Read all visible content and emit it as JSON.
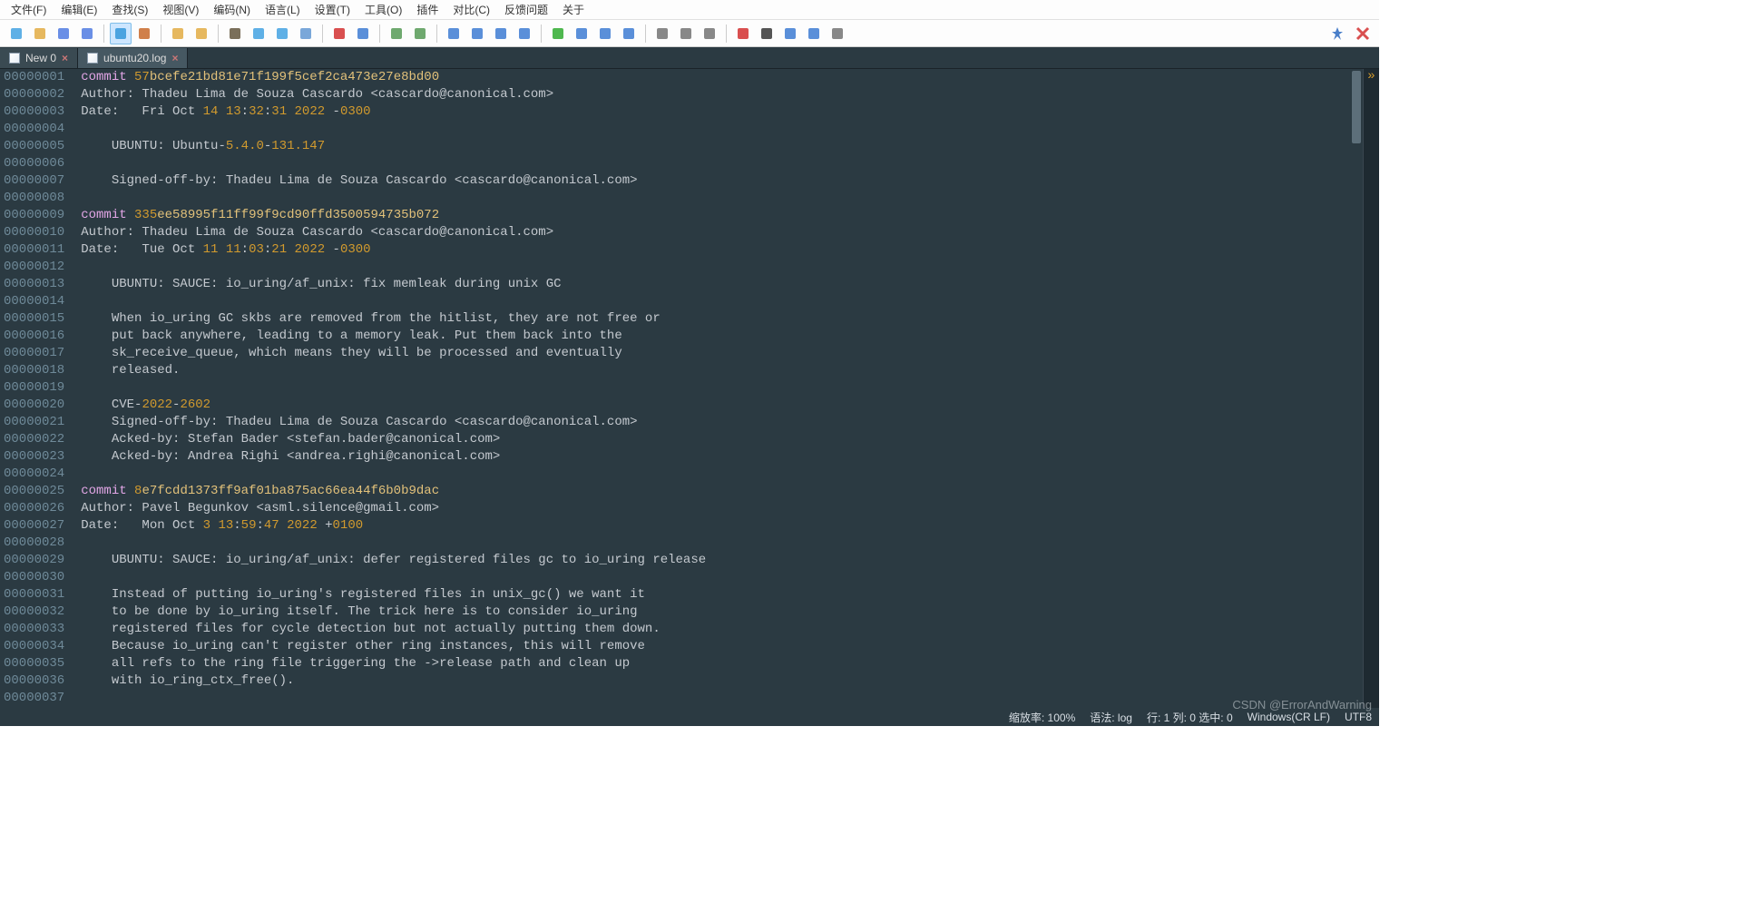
{
  "menu": {
    "items": [
      "文件(F)",
      "编辑(E)",
      "查找(S)",
      "视图(V)",
      "编码(N)",
      "语言(L)",
      "设置(T)",
      "工具(O)",
      "插件",
      "对比(C)",
      "反馈问题",
      "关于"
    ]
  },
  "toolbar": {
    "icons": [
      "new-file-icon",
      "open-folder-icon",
      "save-icon",
      "save-all-icon",
      "sep",
      "clipboard-icon",
      "cut-icon",
      "sep",
      "undo-icon",
      "redo-icon",
      "sep",
      "binoculars-icon",
      "find-replace-icon",
      "doc-search-icon",
      "indent-guide-icon",
      "sep",
      "highlight-red-icon",
      "highlight-blue-icon",
      "sep",
      "zoom-in-icon",
      "zoom-out-icon",
      "sep",
      "align-left-icon",
      "indent-decrease-icon",
      "indent-increase-icon",
      "wrap-icon",
      "sep",
      "play-green-icon",
      "play-blue-icon",
      "link-icon",
      "compare-icon",
      "sep",
      "panel-left-icon",
      "panel-split-icon",
      "panel-right-icon",
      "sep",
      "record-icon",
      "stop-icon",
      "step-icon",
      "fast-icon",
      "export-icon"
    ],
    "active_icon": "clipboard-icon",
    "right": [
      "pin-icon",
      "close-red-icon"
    ]
  },
  "tabs": [
    {
      "label": "New 0",
      "active": false
    },
    {
      "label": "ubuntu20.log",
      "active": true
    }
  ],
  "editor": {
    "line_start": 1,
    "line_count": 37,
    "lines": [
      {
        "n": "00000001",
        "segs": [
          {
            "t": "commit ",
            "c": "kw"
          },
          {
            "t": "57",
            "c": "num"
          },
          {
            "t": "bcefe21bd81e71f199f5cef2ca473e27e8bd00",
            "c": "hash"
          }
        ]
      },
      {
        "n": "00000002",
        "segs": [
          {
            "t": "Author: Thadeu Lima de Souza Cascardo <cascardo@canonical.com>",
            "c": "p"
          }
        ]
      },
      {
        "n": "00000003",
        "segs": [
          {
            "t": "Date:   Fri Oct ",
            "c": "p"
          },
          {
            "t": "14",
            "c": "num"
          },
          {
            "t": " ",
            "c": "p"
          },
          {
            "t": "13",
            "c": "num"
          },
          {
            "t": ":",
            "c": "p"
          },
          {
            "t": "32",
            "c": "num"
          },
          {
            "t": ":",
            "c": "p"
          },
          {
            "t": "31",
            "c": "num"
          },
          {
            "t": " ",
            "c": "p"
          },
          {
            "t": "2022",
            "c": "num"
          },
          {
            "t": " -",
            "c": "p"
          },
          {
            "t": "0300",
            "c": "num"
          }
        ]
      },
      {
        "n": "00000004",
        "segs": []
      },
      {
        "n": "00000005",
        "segs": [
          {
            "t": "    UBUNTU: Ubuntu-",
            "c": "p"
          },
          {
            "t": "5.4.0",
            "c": "num"
          },
          {
            "t": "-",
            "c": "p"
          },
          {
            "t": "131.147",
            "c": "num"
          }
        ]
      },
      {
        "n": "00000006",
        "segs": []
      },
      {
        "n": "00000007",
        "segs": [
          {
            "t": "    Signed-off-by: Thadeu Lima de Souza Cascardo <cascardo@canonical.com>",
            "c": "p"
          }
        ]
      },
      {
        "n": "00000008",
        "segs": []
      },
      {
        "n": "00000009",
        "segs": [
          {
            "t": "commit ",
            "c": "kw"
          },
          {
            "t": "335",
            "c": "num"
          },
          {
            "t": "ee58995f11ff99f9cd90ffd3500594735b072",
            "c": "hash"
          }
        ]
      },
      {
        "n": "00000010",
        "segs": [
          {
            "t": "Author: Thadeu Lima de Souza Cascardo <cascardo@canonical.com>",
            "c": "p"
          }
        ]
      },
      {
        "n": "00000011",
        "segs": [
          {
            "t": "Date:   Tue Oct ",
            "c": "p"
          },
          {
            "t": "11",
            "c": "num"
          },
          {
            "t": " ",
            "c": "p"
          },
          {
            "t": "11",
            "c": "num"
          },
          {
            "t": ":",
            "c": "p"
          },
          {
            "t": "03",
            "c": "num"
          },
          {
            "t": ":",
            "c": "p"
          },
          {
            "t": "21",
            "c": "num"
          },
          {
            "t": " ",
            "c": "p"
          },
          {
            "t": "2022",
            "c": "num"
          },
          {
            "t": " -",
            "c": "p"
          },
          {
            "t": "0300",
            "c": "num"
          }
        ]
      },
      {
        "n": "00000012",
        "segs": []
      },
      {
        "n": "00000013",
        "segs": [
          {
            "t": "    UBUNTU: SAUCE: io_uring/af_unix: fix memleak during unix GC",
            "c": "p"
          }
        ]
      },
      {
        "n": "00000014",
        "segs": []
      },
      {
        "n": "00000015",
        "segs": [
          {
            "t": "    When io_uring GC skbs are removed from the hitlist, they are not free or",
            "c": "p"
          }
        ]
      },
      {
        "n": "00000016",
        "segs": [
          {
            "t": "    put back anywhere, leading to a memory leak. Put them back into the",
            "c": "p"
          }
        ]
      },
      {
        "n": "00000017",
        "segs": [
          {
            "t": "    sk_receive_queue, which means they will be processed and eventually",
            "c": "p"
          }
        ]
      },
      {
        "n": "00000018",
        "segs": [
          {
            "t": "    released.",
            "c": "p"
          }
        ]
      },
      {
        "n": "00000019",
        "segs": []
      },
      {
        "n": "00000020",
        "segs": [
          {
            "t": "    CVE-",
            "c": "p"
          },
          {
            "t": "2022",
            "c": "num"
          },
          {
            "t": "-",
            "c": "p"
          },
          {
            "t": "2602",
            "c": "num"
          }
        ]
      },
      {
        "n": "00000021",
        "segs": [
          {
            "t": "    Signed-off-by: Thadeu Lima de Souza Cascardo <cascardo@canonical.com>",
            "c": "p"
          }
        ]
      },
      {
        "n": "00000022",
        "segs": [
          {
            "t": "    Acked-by: Stefan Bader <stefan.bader@canonical.com>",
            "c": "p"
          }
        ]
      },
      {
        "n": "00000023",
        "segs": [
          {
            "t": "    Acked-by: Andrea Righi <andrea.righi@canonical.com>",
            "c": "p"
          }
        ]
      },
      {
        "n": "00000024",
        "segs": []
      },
      {
        "n": "00000025",
        "segs": [
          {
            "t": "commit ",
            "c": "kw"
          },
          {
            "t": "8",
            "c": "num"
          },
          {
            "t": "e7fcdd1373ff9af01ba875ac66ea44f6b0b9dac",
            "c": "hash"
          }
        ]
      },
      {
        "n": "00000026",
        "segs": [
          {
            "t": "Author: Pavel Begunkov <asml.silence@gmail.com>",
            "c": "p"
          }
        ]
      },
      {
        "n": "00000027",
        "segs": [
          {
            "t": "Date:   Mon Oct ",
            "c": "p"
          },
          {
            "t": "3",
            "c": "num"
          },
          {
            "t": " ",
            "c": "p"
          },
          {
            "t": "13",
            "c": "num"
          },
          {
            "t": ":",
            "c": "p"
          },
          {
            "t": "59",
            "c": "num"
          },
          {
            "t": ":",
            "c": "p"
          },
          {
            "t": "47",
            "c": "num"
          },
          {
            "t": " ",
            "c": "p"
          },
          {
            "t": "2022",
            "c": "num"
          },
          {
            "t": " +",
            "c": "p"
          },
          {
            "t": "0100",
            "c": "num"
          }
        ]
      },
      {
        "n": "00000028",
        "segs": []
      },
      {
        "n": "00000029",
        "segs": [
          {
            "t": "    UBUNTU: SAUCE: io_uring/af_unix: defer registered files gc to io_uring release",
            "c": "p"
          }
        ]
      },
      {
        "n": "00000030",
        "segs": []
      },
      {
        "n": "00000031",
        "segs": [
          {
            "t": "    Instead of putting io_uring's registered files in unix_gc() we want it",
            "c": "p"
          }
        ]
      },
      {
        "n": "00000032",
        "segs": [
          {
            "t": "    to be done by io_uring itself. The trick here is to consider io_uring",
            "c": "p"
          }
        ]
      },
      {
        "n": "00000033",
        "segs": [
          {
            "t": "    registered files for cycle detection but not actually putting them down.",
            "c": "p"
          }
        ]
      },
      {
        "n": "00000034",
        "segs": [
          {
            "t": "    Because io_uring can't register other ring instances, this will remove",
            "c": "p"
          }
        ]
      },
      {
        "n": "00000035",
        "segs": [
          {
            "t": "    all refs to the ring file triggering the ->release path and clean up",
            "c": "p"
          }
        ]
      },
      {
        "n": "00000036",
        "segs": [
          {
            "t": "    with io_ring_ctx_free().",
            "c": "p"
          }
        ]
      },
      {
        "n": "00000037",
        "segs": []
      }
    ]
  },
  "statusbar": {
    "zoom": "缩放率: 100%",
    "lang": "语法: log",
    "pos": "行: 1 列: 0 选中: 0",
    "eol": "Windows(CR LF)",
    "enc": "UTF8"
  },
  "watermark": "CSDN @ErrorAndWarning"
}
